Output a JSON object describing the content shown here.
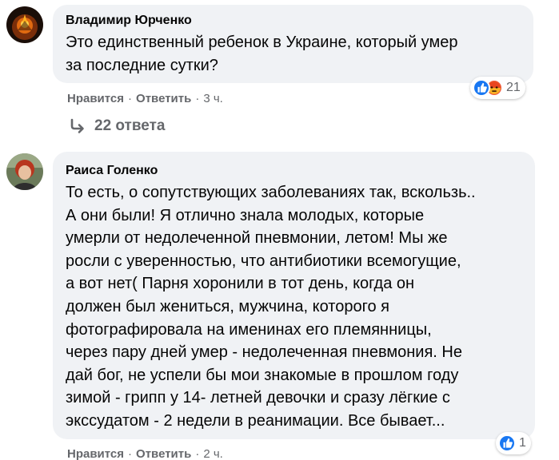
{
  "comments": [
    {
      "author": "Владимир Юрченко",
      "text": "Это единственный ребенок в Украине, который умер\nза последние сутки?",
      "reaction_count": "21",
      "reaction_icons": [
        "like-icon",
        "angry-icon"
      ],
      "like_label": "Нравится",
      "reply_label": "Ответить",
      "time": "3 ч.",
      "replies_label": "22 ответа"
    },
    {
      "author": "Раиса Голенко",
      "text": "То есть, о сопутствующих заболеваниях так, вскользь..\nА они были! Я отлично знала молодых, которые\nумерли от недолеченной пневмонии, летом! Мы же\nросли с уверенностью, что антибиотики всемогущие,\nа вот нет( Парня хоронили в тот день, когда он\nдолжен был жениться, мужчина, которого я\nфотографировала на именинах его племянницы,\nчерез пару дней умер - недолеченная пневмония. Не\nдай бог, не успели бы мои знакомые в прошлом году\nзимой - грипп у 14- летней девочки и сразу лёгкие с\nэкссудатом - 2 недели в реанимации. Все бывает...",
      "reaction_count": "1",
      "reaction_icons": [
        "like-icon"
      ],
      "like_label": "Нравится",
      "reply_label": "Ответить",
      "time": "2 ч."
    }
  ],
  "separator": "·",
  "colors": {
    "bubble": "#f0f2f5",
    "like": "#1877f2",
    "angry": "#f0553a",
    "meta_text": "#65676b"
  }
}
